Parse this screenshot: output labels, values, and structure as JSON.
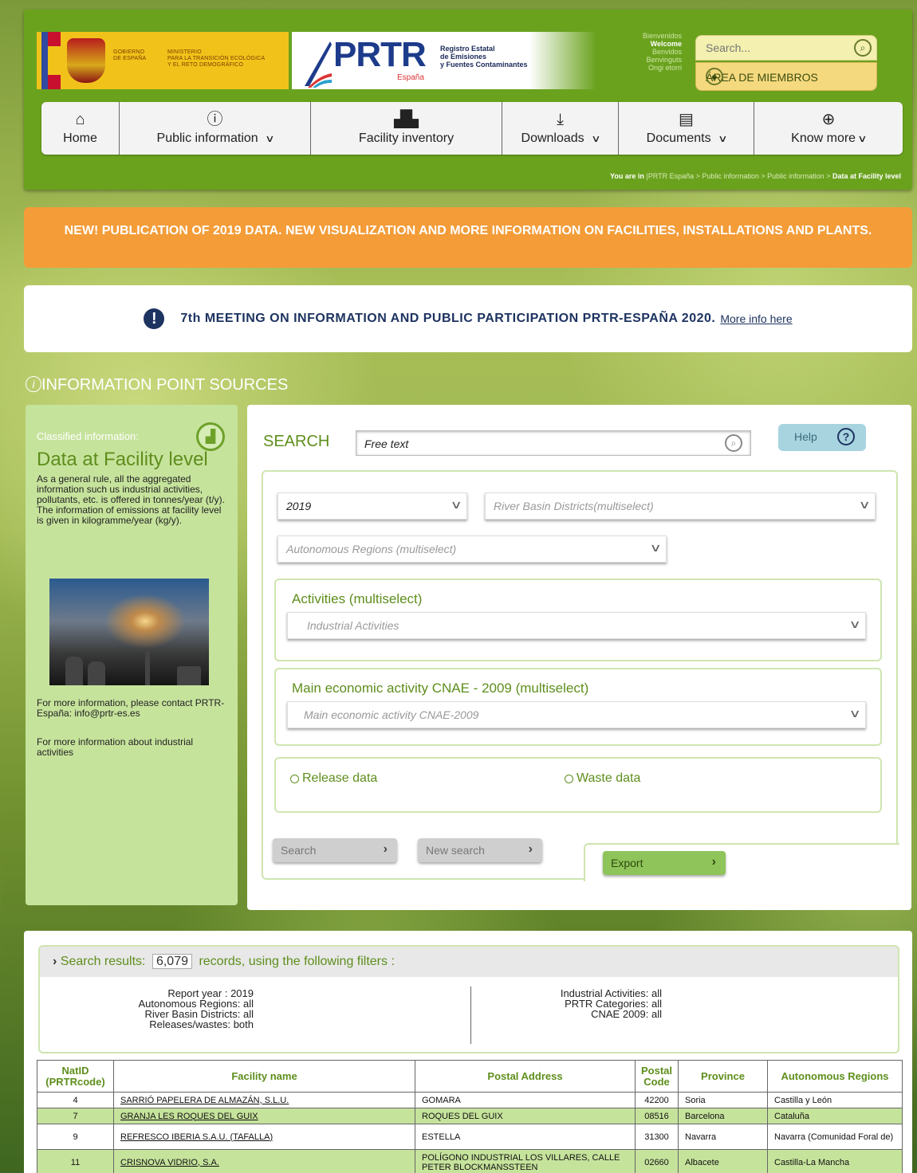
{
  "header": {
    "gov_label": "GOBIERNO\nDE ESPAÑA",
    "ministry_label": "MINISTERIO\nPARA LA TRANSICIÓN ECOLÓGICA\nY EL RETO DEMOGRÁFICO",
    "logo_text": "PRTR",
    "logo_sub": "España",
    "registry_title": "Registro Estatal\nde Emisiones\ny Fuentes Contaminantes",
    "welcome_lines": [
      "Bienvenidos",
      "Welcome",
      "Benvidos",
      "Benvinguts",
      "Ongi etorri"
    ],
    "search_placeholder": "Search...",
    "members_label": "ÁREA DE MIEMBROS"
  },
  "nav": [
    {
      "label": "Home",
      "icon": "home-icon",
      "glyph": "⌂",
      "dropdown": false
    },
    {
      "label": "Public information",
      "icon": "info-icon",
      "glyph": "ⓘ",
      "dropdown": true
    },
    {
      "label": "Facility inventory",
      "icon": "factory-icon",
      "glyph": "▟▙",
      "dropdown": false
    },
    {
      "label": "Downloads",
      "icon": "download-icon",
      "glyph": "⤓",
      "dropdown": true
    },
    {
      "label": "Documents",
      "icon": "documents-icon",
      "glyph": "▤",
      "dropdown": true
    },
    {
      "label": "Know more",
      "icon": "zoom-in-icon",
      "glyph": "⊕",
      "dropdown": true
    }
  ],
  "breadcrumb": {
    "prefix": "You are in",
    "path": "|PRTR España >  Public information >  Public information > ",
    "current": "Data at Facility level"
  },
  "banner_orange": "NEW! PUBLICATION OF 2019 DATA. NEW VISUALIZATION AND MORE INFORMATION ON FACILITIES, INSTALLATIONS AND PLANTS.",
  "notice": {
    "text": "7th MEETING ON INFORMATION AND PUBLIC PARTICIPATION PRTR-ESPAÑA 2020.",
    "link": "More info here"
  },
  "section_title": "INFORMATION POINT SOURCES",
  "left_panel": {
    "classified_label": "Classified information:",
    "title": "Data at Facility level",
    "description": "As a general rule, all the aggregated information such us industrial activities, pollutants, etc. is offered in tonnes/year (t/y). The information of emissions at facility level is given in kilogramme/year (kg/y).",
    "contact": "For more information, please contact PRTR-España: info@prtr-es.es",
    "more_info": "For more information about industrial activities"
  },
  "form": {
    "search_label": "SEARCH",
    "free_text": "Free text",
    "help_label": "Help",
    "year_value": "2019",
    "river_basin_placeholder": "River Basin Districts(multiselect)",
    "regions_placeholder": "Autonomous Regions (multiselect)",
    "activities_title": "Activities (multiselect)",
    "activities_placeholder": "Industrial Activities",
    "cnae_title": "Main economic activity CNAE - 2009 (multiselect)",
    "cnae_placeholder": "Main economic activity CNAE-2009",
    "release_label": "Release data",
    "waste_label": "Waste data",
    "search_button": "Search",
    "new_search_button": "New search",
    "export_button": "Export"
  },
  "results": {
    "prefix": "Search results:",
    "count": "6,079",
    "suffix": "records, using the following filters :",
    "filters_left": [
      "Report year :  2019",
      "Autonomous Regions:  all",
      "River Basin Districts:  all",
      "Releases/wastes:  both"
    ],
    "filters_right": [
      "Industrial Activities:  all",
      "PRTR Categories:  all",
      "CNAE 2009:  all"
    ],
    "columns": [
      "NatID (PRTRcode)",
      "Facility name",
      "Postal Address",
      "Postal Code",
      "Province",
      "Autonomous Regions"
    ],
    "rows": [
      [
        "4",
        "SARRIÓ PAPELERA DE ALMAZÁN, S.L.U.",
        "GOMARA",
        "42200",
        "Soria",
        "Castilla y León"
      ],
      [
        "7",
        "GRANJA LES ROQUES DEL GUIX",
        "ROQUES DEL GUIX",
        "08516",
        "Barcelona",
        "Cataluña"
      ],
      [
        "9",
        "REFRESCO IBERIA S.A.U. (TAFALLA)",
        "ESTELLA",
        "31300",
        "Navarra",
        "Navarra (Comunidad Foral de)"
      ],
      [
        "11",
        "CRISNOVA VIDRIO, S.A.",
        "POLÍGONO INDUSTRIAL LOS VILLARES, CALLE PETER BLOCKMANSSTEEN",
        "02660",
        "Albacete",
        "Castilla-La Mancha"
      ]
    ]
  }
}
